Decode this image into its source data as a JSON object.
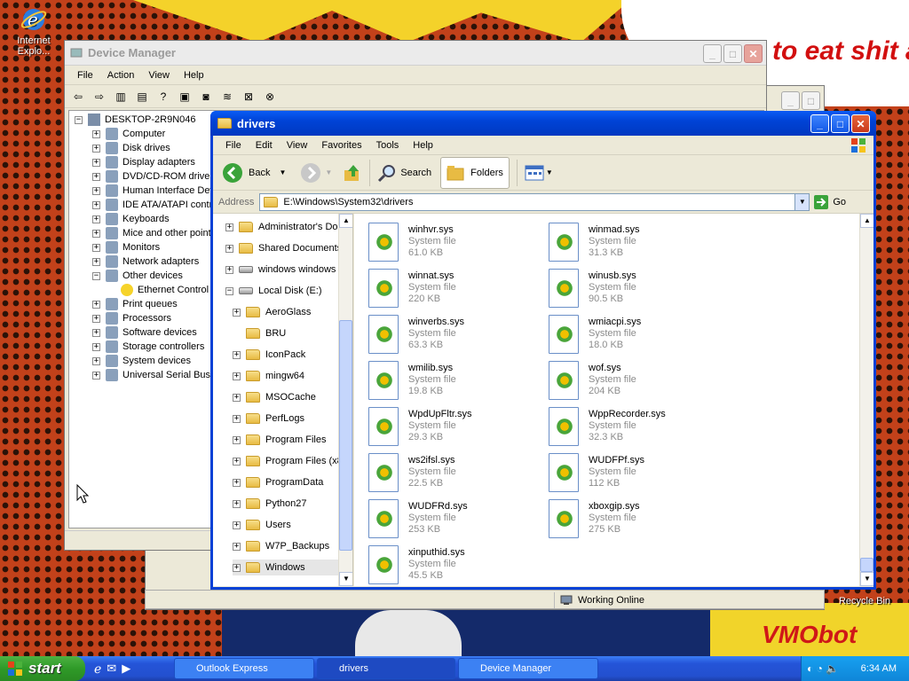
{
  "desktop": {
    "comic_text": "to eat shit and chew",
    "watermark": "VMObot",
    "icons": [
      {
        "label": "Internet Explo...",
        "icon": "internet-explorer-icon"
      },
      {
        "label": "Recycle Bin",
        "icon": "recycle-bin-icon"
      }
    ]
  },
  "device_manager": {
    "title": "Device Manager",
    "menu": [
      "File",
      "Action",
      "View",
      "Help"
    ],
    "root": "DESKTOP-2R9N046",
    "items": [
      {
        "label": "Computer",
        "expanded": false
      },
      {
        "label": "Disk drives",
        "expanded": false
      },
      {
        "label": "Display adapters",
        "expanded": false
      },
      {
        "label": "DVD/CD-ROM drives",
        "expanded": false
      },
      {
        "label": "Human Interface Devi",
        "expanded": false
      },
      {
        "label": "IDE ATA/ATAPI contr",
        "expanded": false
      },
      {
        "label": "Keyboards",
        "expanded": false
      },
      {
        "label": "Mice and other pointi",
        "expanded": false
      },
      {
        "label": "Monitors",
        "expanded": false
      },
      {
        "label": "Network adapters",
        "expanded": false
      },
      {
        "label": "Other devices",
        "expanded": true
      },
      {
        "label": "Ethernet Control",
        "child": true
      },
      {
        "label": "Print queues",
        "expanded": false
      },
      {
        "label": "Processors",
        "expanded": false
      },
      {
        "label": "Software devices",
        "expanded": false
      },
      {
        "label": "Storage controllers",
        "expanded": false
      },
      {
        "label": "System devices",
        "expanded": false
      },
      {
        "label": "Universal Serial Bus c",
        "expanded": false
      }
    ]
  },
  "explorer": {
    "title": "drivers",
    "menu": [
      "File",
      "Edit",
      "View",
      "Favorites",
      "Tools",
      "Help"
    ],
    "toolbar": {
      "back": "Back",
      "search": "Search",
      "folders": "Folders"
    },
    "address_label": "Address",
    "address": "E:\\Windows\\System32\\drivers",
    "go": "Go",
    "folders": [
      {
        "label": "Administrator's Doc",
        "indent": 0,
        "expander": true,
        "icon": "folder"
      },
      {
        "label": "Shared Documents",
        "indent": 0,
        "expander": true,
        "icon": "folder"
      },
      {
        "label": "windows windows",
        "indent": 0,
        "expander": true,
        "icon": "drive"
      },
      {
        "label": "Local Disk (E:)",
        "indent": 0,
        "expander": "minus",
        "icon": "drive"
      },
      {
        "label": "AeroGlass",
        "indent": 1,
        "expander": true,
        "icon": "folder"
      },
      {
        "label": "BRU",
        "indent": 1,
        "expander": false,
        "icon": "folder"
      },
      {
        "label": "IconPack",
        "indent": 1,
        "expander": true,
        "icon": "folder"
      },
      {
        "label": "mingw64",
        "indent": 1,
        "expander": true,
        "icon": "folder"
      },
      {
        "label": "MSOCache",
        "indent": 1,
        "expander": true,
        "icon": "folder"
      },
      {
        "label": "PerfLogs",
        "indent": 1,
        "expander": true,
        "icon": "folder"
      },
      {
        "label": "Program Files",
        "indent": 1,
        "expander": true,
        "icon": "folder"
      },
      {
        "label": "Program Files (x8",
        "indent": 1,
        "expander": true,
        "icon": "folder"
      },
      {
        "label": "ProgramData",
        "indent": 1,
        "expander": true,
        "icon": "folder"
      },
      {
        "label": "Python27",
        "indent": 1,
        "expander": true,
        "icon": "folder"
      },
      {
        "label": "Users",
        "indent": 1,
        "expander": true,
        "icon": "folder"
      },
      {
        "label": "W7P_Backups",
        "indent": 1,
        "expander": true,
        "icon": "folder"
      },
      {
        "label": "Windows",
        "indent": 1,
        "expander": true,
        "icon": "folder",
        "selected": true
      }
    ],
    "files": [
      {
        "name": "winhvr.sys",
        "type": "System file",
        "size": "61.0 KB"
      },
      {
        "name": "winmad.sys",
        "type": "System file",
        "size": "31.3 KB"
      },
      {
        "name": "winnat.sys",
        "type": "System file",
        "size": "220 KB"
      },
      {
        "name": "winusb.sys",
        "type": "System file",
        "size": "90.5 KB"
      },
      {
        "name": "winverbs.sys",
        "type": "System file",
        "size": "63.3 KB"
      },
      {
        "name": "wmiacpi.sys",
        "type": "System file",
        "size": "18.0 KB"
      },
      {
        "name": "wmilib.sys",
        "type": "System file",
        "size": "19.8 KB"
      },
      {
        "name": "wof.sys",
        "type": "System file",
        "size": "204 KB"
      },
      {
        "name": "WpdUpFltr.sys",
        "type": "System file",
        "size": "29.3 KB"
      },
      {
        "name": "WppRecorder.sys",
        "type": "System file",
        "size": "32.3 KB"
      },
      {
        "name": "ws2ifsl.sys",
        "type": "System file",
        "size": "22.5 KB"
      },
      {
        "name": "WUDFPf.sys",
        "type": "System file",
        "size": "112 KB"
      },
      {
        "name": "WUDFRd.sys",
        "type": "System file",
        "size": "253 KB"
      },
      {
        "name": "xboxgip.sys",
        "type": "System file",
        "size": "275 KB"
      },
      {
        "name": "xinputhid.sys",
        "type": "System file",
        "size": "45.5 KB"
      }
    ],
    "status": "Working Online"
  },
  "taskbar": {
    "start": "start",
    "tasks": [
      "Outlook Express",
      "drivers",
      "Device Manager"
    ],
    "clock": "6:34 AM"
  }
}
